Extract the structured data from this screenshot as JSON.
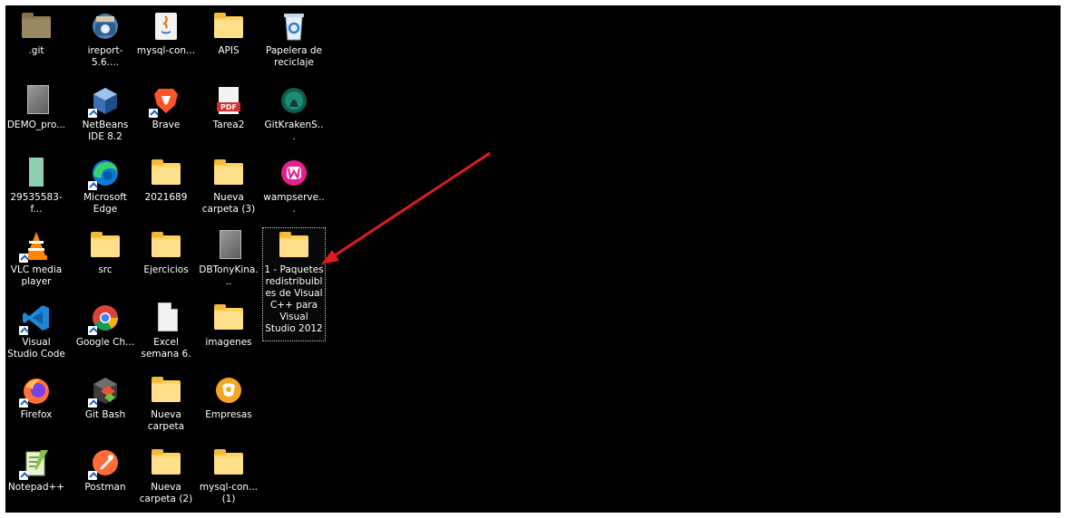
{
  "desktop": {
    "icons": [
      {
        "label": ".git",
        "icon": "folder-dark-icon"
      },
      {
        "label": "ireport-5.6....",
        "icon": "ireport-installer-icon"
      },
      {
        "label": "mysql-con...",
        "icon": "java-jar-icon"
      },
      {
        "label": "APIS",
        "icon": "folder-icon"
      },
      {
        "label": "Papelera de reciclaje",
        "icon": "recycle-bin-icon"
      },
      {
        "label": "DEMO_pro...",
        "icon": "gray-file-icon"
      },
      {
        "label": "NetBeans IDE 8.2",
        "icon": "netbeans-icon"
      },
      {
        "label": "Brave",
        "icon": "brave-icon"
      },
      {
        "label": "Tarea2",
        "icon": "pdf-icon"
      },
      {
        "label": "GitKrakenS...",
        "icon": "gitkraken-icon"
      },
      {
        "label": "29535583-f...",
        "icon": "green-file-icon"
      },
      {
        "label": "Microsoft Edge",
        "icon": "edge-icon"
      },
      {
        "label": "2021689",
        "icon": "folder-icon"
      },
      {
        "label": "Nueva carpeta (3)",
        "icon": "folder-icon"
      },
      {
        "label": "wampserve...",
        "icon": "wampserver-icon"
      },
      {
        "label": "VLC media player",
        "icon": "vlc-icon"
      },
      {
        "label": "src",
        "icon": "folder-icon"
      },
      {
        "label": "Ejercicios",
        "icon": "folder-icon"
      },
      {
        "label": "DBTonyKina...",
        "icon": "gray-file-icon"
      },
      {
        "label": "1 - Paquetes redistribuibles de Visual C++ para Visual Studio 2012",
        "icon": "folder-icon"
      },
      {
        "label": "Visual Studio Code",
        "icon": "vscode-icon"
      },
      {
        "label": "Google Ch...",
        "icon": "chrome-icon"
      },
      {
        "label": "Excel semana 6.",
        "icon": "document-icon"
      },
      {
        "label": "imagenes",
        "icon": "folder-icon"
      },
      {
        "label": "Firefox",
        "icon": "firefox-icon"
      },
      {
        "label": "Git Bash",
        "icon": "git-bash-icon"
      },
      {
        "label": "Nueva carpeta",
        "icon": "folder-icon"
      },
      {
        "label": "Empresas",
        "icon": "empresas-icon"
      },
      {
        "label": "Notepad++",
        "icon": "notepadpp-icon"
      },
      {
        "label": "Postman",
        "icon": "postman-icon"
      },
      {
        "label": "Nueva carpeta (2)",
        "icon": "folder-icon"
      },
      {
        "label": "mysql-con... (1)",
        "icon": "folder-icon"
      }
    ],
    "annotation_color": "#e01b1b",
    "selection_color": "#cfcfcf"
  }
}
